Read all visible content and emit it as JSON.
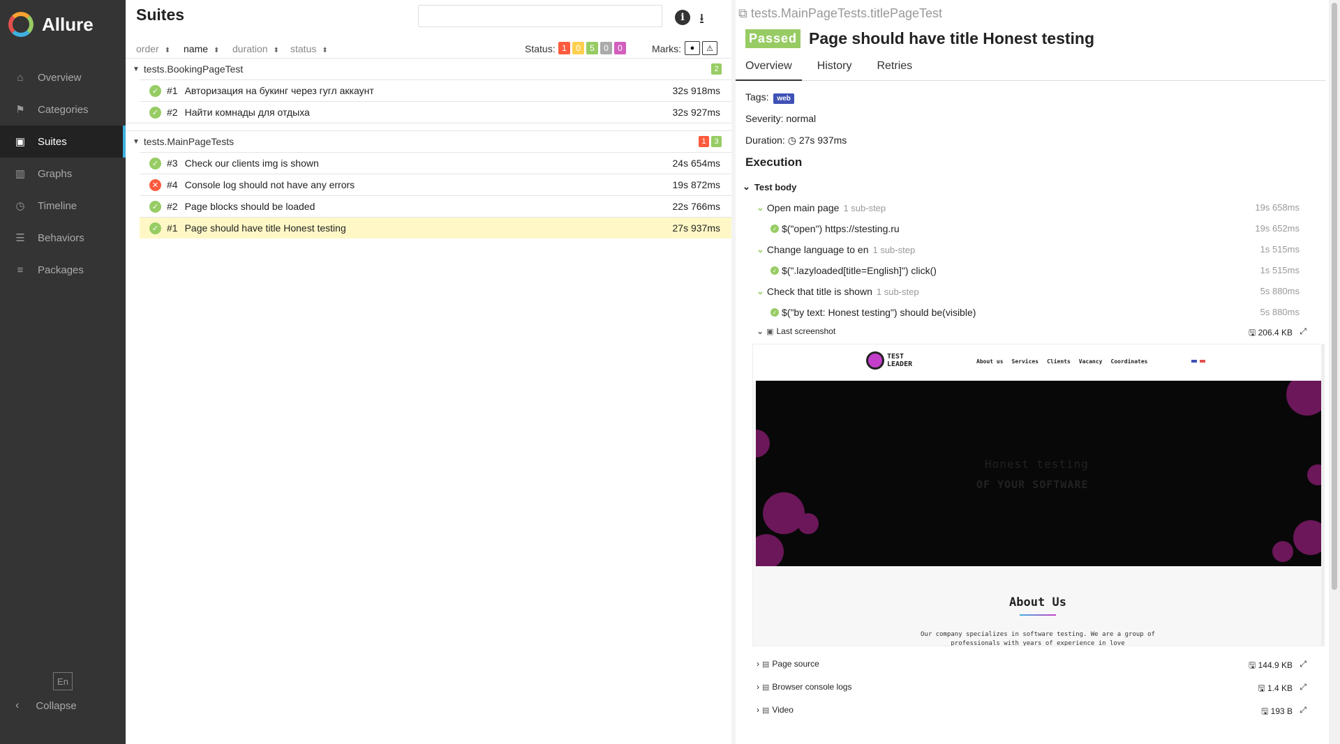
{
  "app": {
    "name": "Allure"
  },
  "sidebar": {
    "items": [
      {
        "label": "Overview",
        "icon": "home-icon",
        "glyph": "⌂"
      },
      {
        "label": "Categories",
        "icon": "flag-icon",
        "glyph": "⚑"
      },
      {
        "label": "Suites",
        "icon": "briefcase-icon",
        "glyph": "▣"
      },
      {
        "label": "Graphs",
        "icon": "bar-chart-icon",
        "glyph": "▥"
      },
      {
        "label": "Timeline",
        "icon": "clock-icon",
        "glyph": "◷"
      },
      {
        "label": "Behaviors",
        "icon": "list-icon",
        "glyph": "☰"
      },
      {
        "label": "Packages",
        "icon": "lines-icon",
        "glyph": "≡"
      }
    ],
    "active": "Suites",
    "lang": "En",
    "collapse": "Collapse"
  },
  "suites": {
    "title": "Suites",
    "search_value": "",
    "sort": {
      "order": "order",
      "name": "name",
      "duration": "duration",
      "status": "status"
    },
    "status_label": "Status:",
    "status_counts": {
      "failed": "1",
      "broken": "0",
      "passed": "5",
      "skipped": "0",
      "unknown": "0"
    },
    "marks_label": "Marks:",
    "groups": [
      {
        "name": "tests.BookingPageTest",
        "counts": {
          "passed": "2"
        },
        "rows": [
          {
            "num": "#1",
            "name": "Авторизация на букинг через гугл аккаунт",
            "duration": "32s 918ms",
            "status": "passed"
          },
          {
            "num": "#2",
            "name": "Найти комнады для отдыха",
            "duration": "32s 927ms",
            "status": "passed"
          }
        ]
      },
      {
        "name": "tests.MainPageTests",
        "counts": {
          "failed": "1",
          "passed": "3"
        },
        "rows": [
          {
            "num": "#3",
            "name": "Check our clients img is shown",
            "duration": "24s 654ms",
            "status": "passed"
          },
          {
            "num": "#4",
            "name": "Console log should not have any errors",
            "duration": "19s 872ms",
            "status": "failed"
          },
          {
            "num": "#2",
            "name": "Page blocks should be loaded",
            "duration": "22s 766ms",
            "status": "passed"
          },
          {
            "num": "#1",
            "name": "Page should have title Honest testing",
            "duration": "27s 937ms",
            "status": "passed"
          }
        ]
      }
    ]
  },
  "detail": {
    "fullname": "tests.MainPageTests.titlePageTest",
    "status": "Passed",
    "title": "Page should have title Honest testing",
    "tabs": [
      "Overview",
      "History",
      "Retries"
    ],
    "tags_label": "Tags:",
    "tag": "web",
    "severity": "Severity: normal",
    "duration_label": "Duration:",
    "duration": "27s 937ms",
    "execution_title": "Execution",
    "test_body": "Test body",
    "steps": [
      {
        "name": "Open main page",
        "sub": "1 sub-step",
        "duration": "19s 658ms"
      },
      {
        "name": "$(\"open\") https://stesting.ru",
        "duration": "19s 652ms"
      },
      {
        "name": "Change language to en",
        "sub": "1 sub-step",
        "duration": "1s 515ms"
      },
      {
        "name": "$(\".lazyloaded[title=English]\") click()",
        "duration": "1s 515ms"
      },
      {
        "name": "Check that title is shown",
        "sub": "1 sub-step",
        "duration": "5s 880ms"
      },
      {
        "name": "$(\"by text: Honest testing\") should be(visible)",
        "duration": "5s 880ms"
      }
    ],
    "attachments": [
      {
        "name": "Last screenshot",
        "size": "206.4 KB"
      },
      {
        "name": "Page source",
        "size": "144.9 KB"
      },
      {
        "name": "Browser console logs",
        "size": "1.4 KB"
      },
      {
        "name": "Video",
        "size": "193 B"
      }
    ],
    "screenshot": {
      "logo_line1": "TEST",
      "logo_line2": "LEADER",
      "menu": [
        "About us",
        "Services",
        "Clients",
        "Vacancy",
        "Coordinates"
      ],
      "hero_line1": "Honest testing",
      "hero_line2": "OF YOUR SOFTWARE",
      "about_title": "About Us",
      "about_text": "Our company specializes in software testing. We are a group of professionals with years of experience in love"
    }
  }
}
